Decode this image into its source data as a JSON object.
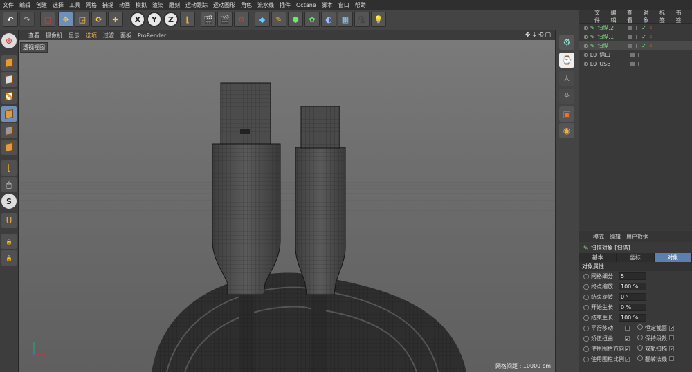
{
  "menu": [
    "文件",
    "编辑",
    "创建",
    "选择",
    "工具",
    "网格",
    "捕捉",
    "动画",
    "模拟",
    "渲染",
    "雕刻",
    "运动跟踪",
    "运动图形",
    "角色",
    "流水线",
    "插件",
    "Octane",
    "脚本",
    "窗口",
    "帮助"
  ],
  "toolbar": {
    "x": "X",
    "y": "Y",
    "z": "Z"
  },
  "viewport": {
    "menu": [
      "查看",
      "摄像机",
      "显示",
      "选项",
      "过滤",
      "面板",
      "ProRender"
    ],
    "highlight": "选项",
    "label": "透视视图",
    "status": "网格间距 : 10000 cm",
    "controls": "✥↓⟲▢"
  },
  "objects": {
    "tabs": [
      "文件",
      "编辑",
      "查看",
      "对象",
      "标签",
      "书签"
    ],
    "rows": [
      {
        "name": "扫描.2",
        "type": "sweep"
      },
      {
        "name": "扫描.1",
        "type": "sweep"
      },
      {
        "name": "扫描",
        "type": "sweep"
      },
      {
        "name": "插口",
        "type": "null"
      },
      {
        "name": "USB",
        "type": "null"
      }
    ]
  },
  "attributes": {
    "tabs": [
      "模式",
      "编辑",
      "用户数据"
    ],
    "title": "扫描对象 [扫描]",
    "subtabs": [
      "基本",
      "坐标",
      "对象"
    ],
    "section": "对象属性",
    "fields": [
      {
        "label": "网格细分",
        "value": "5"
      },
      {
        "label": "终点缩放",
        "value": "100 %"
      },
      {
        "label": "结束旋转",
        "value": "0 °"
      },
      {
        "label": "开始生长",
        "value": "0 %"
      },
      {
        "label": "结束生长",
        "value": "100 %"
      }
    ],
    "checks": [
      {
        "left": "平行移动",
        "lv": false,
        "right": "恒定截面",
        "rv": true
      },
      {
        "left": "矫正扭曲",
        "lv": true,
        "right": "保持段数",
        "rv": false
      },
      {
        "left": "使用围栏方向",
        "lv": true,
        "right": "双轨扫描",
        "rv": true
      },
      {
        "left": "使用围栏比例",
        "lv": true,
        "right": "翻转法线",
        "rv": false
      }
    ]
  }
}
